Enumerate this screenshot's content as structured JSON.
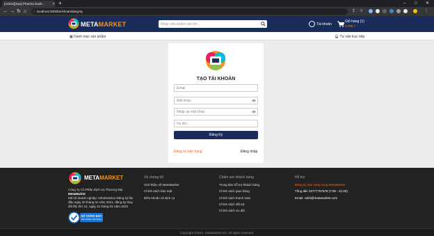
{
  "browser": {
    "tab_title": "[Admin][Spa] Pharma Dash...",
    "address": "localhost:3000/tai-khoan/dang-ky"
  },
  "header": {
    "logo_main": "META",
    "logo_accent": "MARKET",
    "search_placeholder": "Nhập sản phẩm cần tìm ...",
    "account_label": "Tài khoản",
    "cart_title": "Giỏ hàng (1)",
    "cart_price": "4.790 ₫"
  },
  "catbar": {
    "categories_label": "Danh mục sản phẩm",
    "support_label": "Tư vấn trực tiếp"
  },
  "register": {
    "title": "TẠO TÀI KHOẢN",
    "email_placeholder": "Email",
    "password_placeholder": "Mật khẩu",
    "confirm_placeholder": "Nhập lại mật khẩu",
    "name_placeholder": "Họ tên",
    "submit_label": "Đăng Ký",
    "seller_link": "Đăng ký bán hàng",
    "login_link": "Đăng nhập"
  },
  "footer": {
    "logo_main": "META",
    "logo_accent": "MARKET",
    "company_line1": "Công Ty Cổ Phần Dịch Vụ Thương Mại",
    "company_name": "MetaMarket",
    "company_detail": "Mã số doanh nghiệp: 0204518412 Đăng ký lần đầu ngày 30 tháng 02 năm 2021, đăng ký thay đổi lần thứ 24, ngày 31 tháng 02 năm 2022",
    "badge_line1": "ĐÃ THÔNG BÁO",
    "badge_line2": "BỘ CÔNG THƯƠNG",
    "about_title": "Về chúng tôi",
    "about_items": [
      "Giới thiệu về MetaMarket",
      "Chính sách bảo mật",
      "Điều khoản và dịch vụ"
    ],
    "care_title": "Chăm sóc khách hàng",
    "care_items": [
      "Trung tâm hỗ trợ khách hàng",
      "Chính sách giao hàng",
      "Chính sách thanh toán",
      "Chính sách đổi trả",
      "Chính sách ưu đãi"
    ],
    "support_title": "Hỗ trợ",
    "support_link": "Đăng ký bán hàng cùng MetaMarket",
    "hotline": "Tổng đài: 03777757578 (7:00 - 21:00)",
    "email": "Email: cskh@metamarket.com",
    "copyright": "Copyright ©2021, MetaMarket Inc. All rights reserved."
  },
  "colors": {
    "brand_navy": "#1a2c5a",
    "brand_orange": "#f7931e",
    "link_orange": "#f26522"
  }
}
